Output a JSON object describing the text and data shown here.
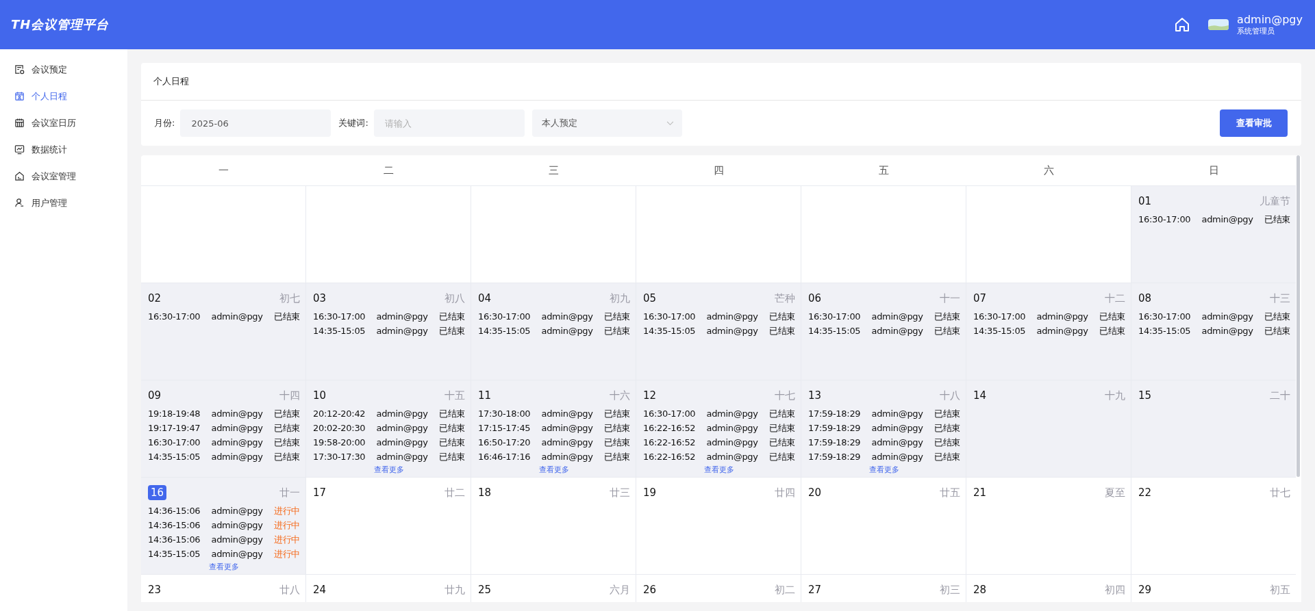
{
  "header": {
    "logo": "TH会议管理平台",
    "user": {
      "name": "admin@pgy",
      "role": "系统管理员"
    }
  },
  "sidebar": {
    "items": [
      {
        "label": "会议预定",
        "selected": false
      },
      {
        "label": "个人日程",
        "selected": true
      },
      {
        "label": "会议室日历",
        "selected": false
      },
      {
        "label": "数据统计",
        "selected": false
      },
      {
        "label": "会议室管理",
        "selected": false
      },
      {
        "label": "用户管理",
        "selected": false
      }
    ]
  },
  "page": {
    "title": "个人日程"
  },
  "filters": {
    "month_label": "月份:",
    "month_value": "2025-06",
    "keyword_label": "关键词:",
    "keyword_placeholder": "请输入",
    "scope_value": "本人预定",
    "button": "查看审批"
  },
  "calendar": {
    "weekdays": [
      "一",
      "二",
      "三",
      "四",
      "五",
      "六",
      "日"
    ],
    "weeks": [
      [
        {
          "past": false
        },
        {
          "past": false
        },
        {
          "past": false
        },
        {
          "past": false
        },
        {
          "past": false
        },
        {
          "past": false
        },
        {
          "date": "01",
          "lunar": "儿童节",
          "past": true,
          "today": false,
          "events": [
            {
              "time": "16:30-17:00",
              "user": "admin@pgy",
              "status": "已结束",
              "kind": "ended"
            }
          ]
        }
      ],
      [
        {
          "date": "02",
          "lunar": "初七",
          "past": true,
          "today": false,
          "events": [
            {
              "time": "16:30-17:00",
              "user": "admin@pgy",
              "status": "已结束",
              "kind": "ended"
            }
          ]
        },
        {
          "date": "03",
          "lunar": "初八",
          "past": true,
          "today": false,
          "events": [
            {
              "time": "16:30-17:00",
              "user": "admin@pgy",
              "status": "已结束",
              "kind": "ended"
            },
            {
              "time": "14:35-15:05",
              "user": "admin@pgy",
              "status": "已结束",
              "kind": "ended"
            }
          ]
        },
        {
          "date": "04",
          "lunar": "初九",
          "past": true,
          "today": false,
          "events": [
            {
              "time": "16:30-17:00",
              "user": "admin@pgy",
              "status": "已结束",
              "kind": "ended"
            },
            {
              "time": "14:35-15:05",
              "user": "admin@pgy",
              "status": "已结束",
              "kind": "ended"
            }
          ]
        },
        {
          "date": "05",
          "lunar": "芒种",
          "past": true,
          "today": false,
          "events": [
            {
              "time": "16:30-17:00",
              "user": "admin@pgy",
              "status": "已结束",
              "kind": "ended"
            },
            {
              "time": "14:35-15:05",
              "user": "admin@pgy",
              "status": "已结束",
              "kind": "ended"
            }
          ]
        },
        {
          "date": "06",
          "lunar": "十一",
          "past": true,
          "today": false,
          "events": [
            {
              "time": "16:30-17:00",
              "user": "admin@pgy",
              "status": "已结束",
              "kind": "ended"
            },
            {
              "time": "14:35-15:05",
              "user": "admin@pgy",
              "status": "已结束",
              "kind": "ended"
            }
          ]
        },
        {
          "date": "07",
          "lunar": "十二",
          "past": true,
          "today": false,
          "events": [
            {
              "time": "16:30-17:00",
              "user": "admin@pgy",
              "status": "已结束",
              "kind": "ended"
            },
            {
              "time": "14:35-15:05",
              "user": "admin@pgy",
              "status": "已结束",
              "kind": "ended"
            }
          ]
        },
        {
          "date": "08",
          "lunar": "十三",
          "past": true,
          "today": false,
          "events": [
            {
              "time": "16:30-17:00",
              "user": "admin@pgy",
              "status": "已结束",
              "kind": "ended"
            },
            {
              "time": "14:35-15:05",
              "user": "admin@pgy",
              "status": "已结束",
              "kind": "ended"
            }
          ]
        }
      ],
      [
        {
          "date": "09",
          "lunar": "十四",
          "past": true,
          "today": false,
          "events": [
            {
              "time": "19:18-19:48",
              "user": "admin@pgy",
              "status": "已结束",
              "kind": "ended"
            },
            {
              "time": "19:17-19:47",
              "user": "admin@pgy",
              "status": "已结束",
              "kind": "ended"
            },
            {
              "time": "16:30-17:00",
              "user": "admin@pgy",
              "status": "已结束",
              "kind": "ended"
            },
            {
              "time": "14:35-15:05",
              "user": "admin@pgy",
              "status": "已结束",
              "kind": "ended"
            }
          ]
        },
        {
          "date": "10",
          "lunar": "十五",
          "past": true,
          "today": false,
          "events": [
            {
              "time": "20:12-20:42",
              "user": "admin@pgy",
              "status": "已结束",
              "kind": "ended"
            },
            {
              "time": "20:02-20:30",
              "user": "admin@pgy",
              "status": "已结束",
              "kind": "ended"
            },
            {
              "time": "19:58-20:00",
              "user": "admin@pgy",
              "status": "已结束",
              "kind": "ended"
            },
            {
              "time": "17:30-17:30",
              "user": "admin@pgy",
              "status": "已结束",
              "kind": "ended"
            }
          ],
          "more": "查看更多"
        },
        {
          "date": "11",
          "lunar": "十六",
          "past": true,
          "today": false,
          "events": [
            {
              "time": "17:30-18:00",
              "user": "admin@pgy",
              "status": "已结束",
              "kind": "ended"
            },
            {
              "time": "17:15-17:45",
              "user": "admin@pgy",
              "status": "已结束",
              "kind": "ended"
            },
            {
              "time": "16:50-17:20",
              "user": "admin@pgy",
              "status": "已结束",
              "kind": "ended"
            },
            {
              "time": "16:46-17:16",
              "user": "admin@pgy",
              "status": "已结束",
              "kind": "ended"
            }
          ],
          "more": "查看更多"
        },
        {
          "date": "12",
          "lunar": "十七",
          "past": true,
          "today": false,
          "events": [
            {
              "time": "16:30-17:00",
              "user": "admin@pgy",
              "status": "已结束",
              "kind": "ended"
            },
            {
              "time": "16:22-16:52",
              "user": "admin@pgy",
              "status": "已结束",
              "kind": "ended"
            },
            {
              "time": "16:22-16:52",
              "user": "admin@pgy",
              "status": "已结束",
              "kind": "ended"
            },
            {
              "time": "16:22-16:52",
              "user": "admin@pgy",
              "status": "已结束",
              "kind": "ended"
            }
          ],
          "more": "查看更多"
        },
        {
          "date": "13",
          "lunar": "十八",
          "past": true,
          "today": false,
          "events": [
            {
              "time": "17:59-18:29",
              "user": "admin@pgy",
              "status": "已结束",
              "kind": "ended"
            },
            {
              "time": "17:59-18:29",
              "user": "admin@pgy",
              "status": "已结束",
              "kind": "ended"
            },
            {
              "time": "17:59-18:29",
              "user": "admin@pgy",
              "status": "已结束",
              "kind": "ended"
            },
            {
              "time": "17:59-18:29",
              "user": "admin@pgy",
              "status": "已结束",
              "kind": "ended"
            }
          ],
          "more": "查看更多"
        },
        {
          "date": "14",
          "lunar": "十九",
          "past": true,
          "today": false
        },
        {
          "date": "15",
          "lunar": "二十",
          "past": true,
          "today": false
        }
      ],
      [
        {
          "date": "16",
          "lunar": "廿一",
          "past": true,
          "today": true,
          "events": [
            {
              "time": "14:36-15:06",
              "user": "admin@pgy",
              "status": "进行中",
              "kind": "ongoing"
            },
            {
              "time": "14:36-15:06",
              "user": "admin@pgy",
              "status": "进行中",
              "kind": "ongoing"
            },
            {
              "time": "14:36-15:06",
              "user": "admin@pgy",
              "status": "进行中",
              "kind": "ongoing"
            },
            {
              "time": "14:35-15:05",
              "user": "admin@pgy",
              "status": "进行中",
              "kind": "ongoing"
            }
          ],
          "more": "查看更多"
        },
        {
          "date": "17",
          "lunar": "廿二",
          "past": false,
          "today": false
        },
        {
          "date": "18",
          "lunar": "廿三",
          "past": false,
          "today": false
        },
        {
          "date": "19",
          "lunar": "廿四",
          "past": false,
          "today": false
        },
        {
          "date": "20",
          "lunar": "廿五",
          "past": false,
          "today": false
        },
        {
          "date": "21",
          "lunar": "夏至",
          "past": false,
          "today": false
        },
        {
          "date": "22",
          "lunar": "廿七",
          "past": false,
          "today": false
        }
      ],
      [
        {
          "date": "23",
          "lunar": "廿八",
          "past": false,
          "today": false
        },
        {
          "date": "24",
          "lunar": "廿九",
          "past": false,
          "today": false
        },
        {
          "date": "25",
          "lunar": "六月",
          "past": false,
          "today": false
        },
        {
          "date": "26",
          "lunar": "初二",
          "past": false,
          "today": false
        },
        {
          "date": "27",
          "lunar": "初三",
          "past": false,
          "today": false
        },
        {
          "date": "28",
          "lunar": "初四",
          "past": false,
          "today": false
        },
        {
          "date": "29",
          "lunar": "初五",
          "past": false,
          "today": false
        }
      ]
    ]
  }
}
